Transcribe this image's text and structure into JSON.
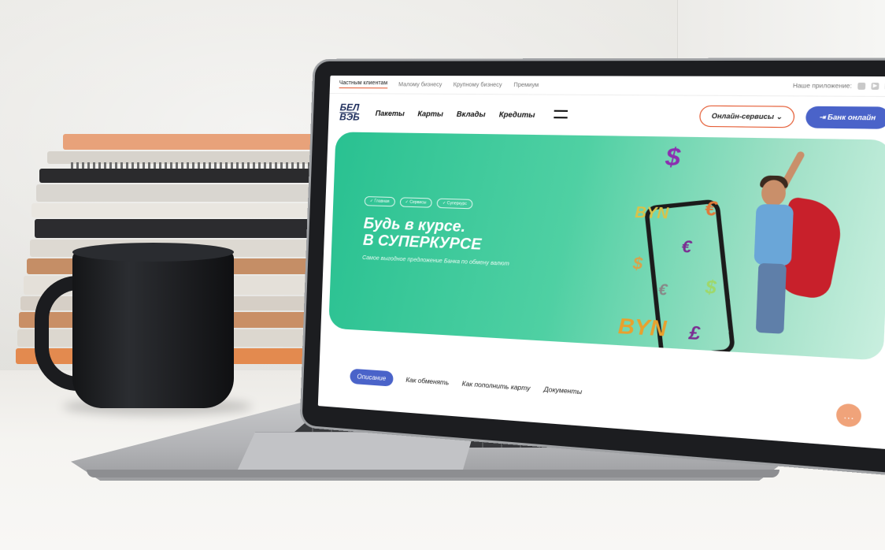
{
  "topbar": {
    "tabs": [
      "Частным клиентам",
      "Малому бизнесу",
      "Крупному бизнесу",
      "Премиум"
    ],
    "apps_label": "Наше приложение:"
  },
  "header": {
    "logo_top": "БЕЛ",
    "logo_bottom": "ВЭБ",
    "nav": [
      "Пакеты",
      "Карты",
      "Вклады",
      "Кредиты"
    ],
    "online_services": "Онлайн-сервисы",
    "bank_online": "Банк онлайн"
  },
  "hero": {
    "breadcrumbs": [
      "Главная",
      "Сервисы",
      "Суперкурс"
    ],
    "title_line1": "Будь в курсе.",
    "title_line2": "В СУПЕРКУРСЕ",
    "subtitle": "Самое выгодное предложение Банка по обмену валют",
    "coins": [
      "$",
      "BYN",
      "€",
      "€",
      "$",
      "€",
      "$",
      "BYN",
      "£"
    ]
  },
  "page_tabs": [
    "Описание",
    "Как обменять",
    "Как пополнить карту",
    "Документы"
  ],
  "colors": {
    "accent_orange": "#e4572e",
    "accent_blue": "#4a63c9",
    "hero_green": "#29c191"
  },
  "icons": {
    "chat": "chat-bubble-icon",
    "menu": "hamburger-menu-icon",
    "apple": "apple-icon",
    "play": "google-play-icon",
    "huawei": "app-gallery-icon"
  }
}
